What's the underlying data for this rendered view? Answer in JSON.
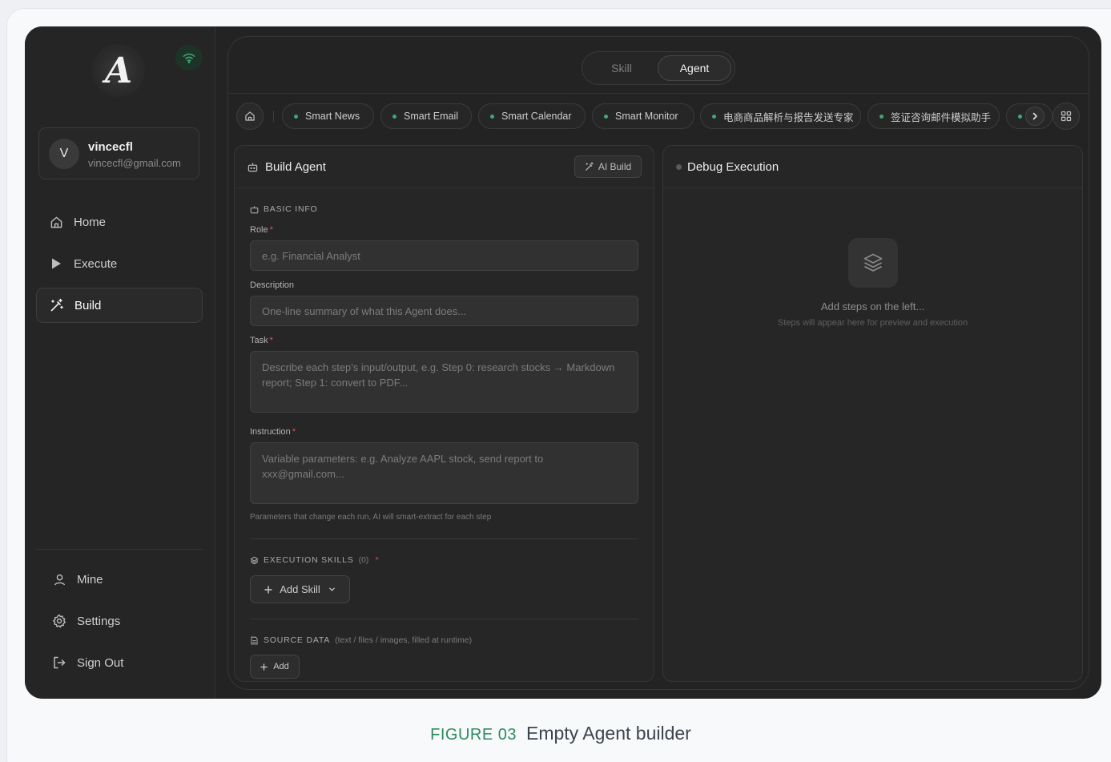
{
  "app": {
    "logo_letter": "A",
    "accent_color": "#3fa873"
  },
  "user": {
    "initial": "V",
    "name": "vincecfl",
    "email": "vincecfl@gmail.com"
  },
  "sidebar": {
    "items": [
      {
        "label": "Home",
        "icon": "home-icon"
      },
      {
        "label": "Execute",
        "icon": "play-icon"
      },
      {
        "label": "Build",
        "icon": "magic-wand-icon",
        "active": true
      }
    ],
    "bottom_items": [
      {
        "label": "Mine",
        "icon": "user-icon"
      },
      {
        "label": "Settings",
        "icon": "gear-icon"
      },
      {
        "label": "Sign Out",
        "icon": "sign-out-icon"
      }
    ]
  },
  "mode_toggle": {
    "options": [
      "Skill",
      "Agent"
    ],
    "selected": "Agent"
  },
  "tabs": [
    "Smart News",
    "Smart Email",
    "Smart Calendar",
    "Smart Monitor",
    "电商商品解析与报告发送专家",
    "签证咨询邮件模拟助手",
    ""
  ],
  "build_panel": {
    "title": "Build Agent",
    "ai_build_label": "AI Build",
    "basic_info_label": "BASIC INFO",
    "role": {
      "label": "Role",
      "required": "*",
      "placeholder": "e.g. Financial Analyst"
    },
    "description": {
      "label": "Description",
      "placeholder": "One-line summary of what this Agent does..."
    },
    "task": {
      "label": "Task",
      "required": "*",
      "placeholder": "Describe each step's input/output, e.g. Step 0: research stocks → Markdown report; Step 1: convert to PDF..."
    },
    "instruction": {
      "label": "Instruction",
      "required": "*",
      "placeholder": "Variable parameters: e.g. Analyze AAPL stock, send report to xxx@gmail.com..."
    },
    "instruction_hint": "Parameters that change each run, AI will smart-extract for each step",
    "execution_skills": {
      "label": "EXECUTION SKILLS",
      "count": "(0)",
      "required": "*",
      "add_label": "Add Skill"
    },
    "source_data": {
      "label": "SOURCE DATA",
      "note": "(text / files / images, filled at runtime)",
      "add_label": "Add"
    }
  },
  "debug_panel": {
    "title": "Debug Execution",
    "empty_title": "Add steps on the left...",
    "empty_subtitle": "Steps will appear here for preview and execution"
  },
  "caption": {
    "figure": "FIGURE 03",
    "text": "Empty Agent builder"
  }
}
